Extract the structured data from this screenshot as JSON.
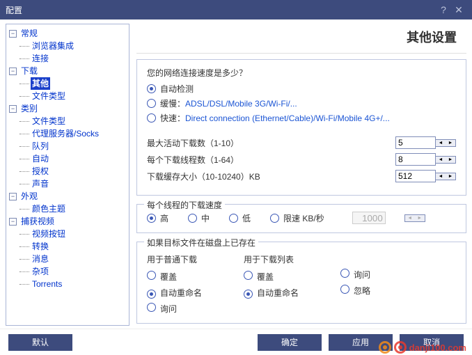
{
  "window": {
    "title": "配置"
  },
  "tree": {
    "general": {
      "label": "常规",
      "children": {
        "browser": "浏览器集成",
        "conn": "连接"
      }
    },
    "download": {
      "label": "下载",
      "children": {
        "other": "其他",
        "filetype": "文件类型"
      }
    },
    "category": {
      "label": "类别",
      "children": {
        "filetype": "文件类型",
        "proxy": "代理服务器/Socks",
        "queue": "队列",
        "auto": "自动",
        "auth": "授权",
        "sound": "声音"
      }
    },
    "appearance": {
      "label": "外观",
      "children": {
        "theme": "颜色主题"
      }
    },
    "capture": {
      "label": "捕获视频",
      "children": {
        "videobtn": "视频按钮",
        "convert": "转换",
        "msg": "消息",
        "misc": "杂项",
        "torrents": "Torrents"
      }
    }
  },
  "page": {
    "title": "其他设置",
    "speedQ": "您的网络连接速度是多少？",
    "opt_auto": "自动检测",
    "opt_slow_prefix": "缓慢：",
    "opt_slow_rest": "ADSL/DSL/Mobile 3G/Wi-Fi/...",
    "opt_fast_prefix": "快速：",
    "opt_fast_rest": "Direct connection (Ethernet/Cable)/Wi-Fi/Mobile 4G+/...",
    "maxActive": {
      "label": "最大活动下载数（1-10）",
      "value": "5"
    },
    "threads": {
      "label": "每个下载线程数（1-64）",
      "value": "8"
    },
    "buffer": {
      "label": "下载缓存大小（10-10240）KB",
      "value": "512"
    },
    "perThreadTitle": "每个线程的下载速度",
    "spd_high": "高",
    "spd_mid": "中",
    "spd_low": "低",
    "spd_limit": "限速 KB/秒",
    "spd_limit_val": "1000",
    "existTitle": "如果目标文件在磁盘上已存在",
    "col1": "用于普通下载",
    "col2": "用于下载列表",
    "o_over": "覆盖",
    "o_auto": "自动重命名",
    "o_ask": "询问",
    "o_ignore": "忽略"
  },
  "footer": {
    "default": "默认",
    "ok": "确定",
    "apply": "应用",
    "cancel": "取消"
  },
  "watermark": "danji100.com"
}
